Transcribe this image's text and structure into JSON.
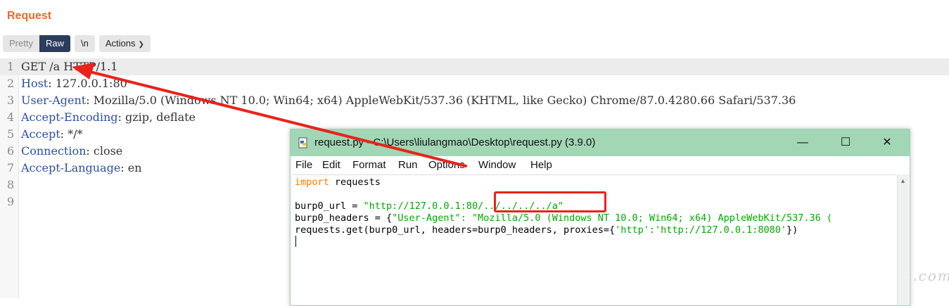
{
  "panel": {
    "title": "Request"
  },
  "toolbar": {
    "pretty_label": "Pretty",
    "raw_label": "Raw",
    "newline_label": "\\n",
    "actions_label": "Actions"
  },
  "request_lines": [
    {
      "num": "1",
      "text": "GET /a HTTP/1.1"
    },
    {
      "num": "2",
      "name": "Host",
      "value": ": 127.0.0.1:80"
    },
    {
      "num": "3",
      "name": "User-Agent",
      "value": ": Mozilla/5.0 (Windows NT 10.0; Win64; x64) AppleWebKit/537.36 (KHTML, like Gecko) Chrome/87.0.4280.66 Safari/537.36"
    },
    {
      "num": "4",
      "name": "Accept-Encoding",
      "value": ": gzip, deflate"
    },
    {
      "num": "5",
      "name": "Accept",
      "value": ": */*"
    },
    {
      "num": "6",
      "name": "Connection",
      "value": ": close"
    },
    {
      "num": "7",
      "name": "Accept-Language",
      "value": ": en"
    },
    {
      "num": "8"
    },
    {
      "num": "9"
    }
  ],
  "idle_window": {
    "title": "request.py - C:\\Users\\liulangmao\\Desktop\\request.py (3.9.0)",
    "menu": [
      "File",
      "Edit",
      "Format",
      "Run",
      "Options",
      "Window",
      "Help"
    ],
    "code": {
      "line1_kw": "import",
      "line1_rest": " requests",
      "line3_a": "burp0_url = ",
      "line3_str": "\"http://127.0.0.1:80/../../../../a\"",
      "line4_a": "burp0_headers = {",
      "line4_str": "\"User-Agent\": \"Mozilla/5.0 (Windows NT 10.0; Win64; x64) AppleWebKit/537.36 (",
      "line5_a": "requests.get(burp0_url, headers=burp0_headers, proxies={",
      "line5_str": "'http':'http://127.0.0.1:8080'",
      "line5_b": "})"
    }
  },
  "watermark": "testerhome.com",
  "colors": {
    "accent": "#e8692c",
    "raw_active": "#2b3c5c",
    "header_name": "#2c4ea3",
    "annotation": "#e8231c",
    "idle_titlebar": "#a2d6b5"
  }
}
